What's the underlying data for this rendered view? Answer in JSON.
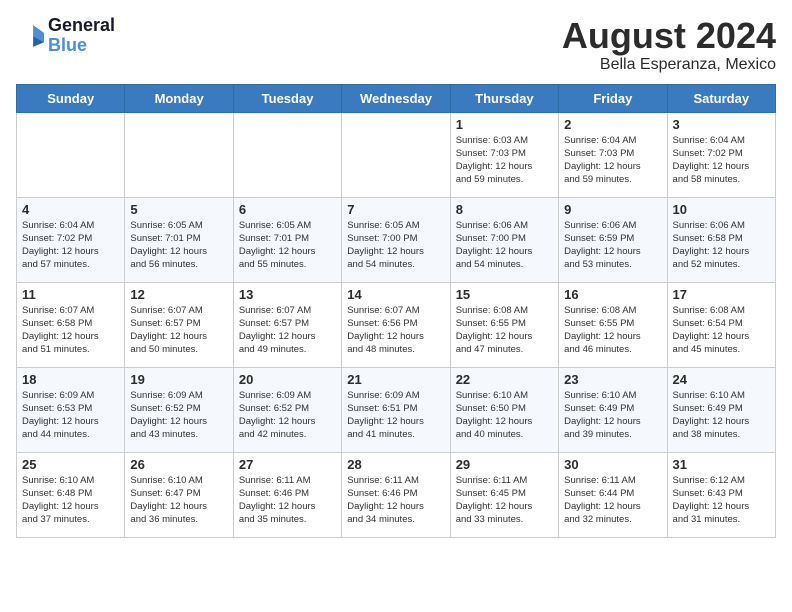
{
  "header": {
    "logo_line1": "General",
    "logo_line2": "Blue",
    "month_year": "August 2024",
    "location": "Bella Esperanza, Mexico"
  },
  "weekdays": [
    "Sunday",
    "Monday",
    "Tuesday",
    "Wednesday",
    "Thursday",
    "Friday",
    "Saturday"
  ],
  "weeks": [
    [
      {
        "day": "",
        "info": ""
      },
      {
        "day": "",
        "info": ""
      },
      {
        "day": "",
        "info": ""
      },
      {
        "day": "",
        "info": ""
      },
      {
        "day": "1",
        "info": "Sunrise: 6:03 AM\nSunset: 7:03 PM\nDaylight: 12 hours\nand 59 minutes."
      },
      {
        "day": "2",
        "info": "Sunrise: 6:04 AM\nSunset: 7:03 PM\nDaylight: 12 hours\nand 59 minutes."
      },
      {
        "day": "3",
        "info": "Sunrise: 6:04 AM\nSunset: 7:02 PM\nDaylight: 12 hours\nand 58 minutes."
      }
    ],
    [
      {
        "day": "4",
        "info": "Sunrise: 6:04 AM\nSunset: 7:02 PM\nDaylight: 12 hours\nand 57 minutes."
      },
      {
        "day": "5",
        "info": "Sunrise: 6:05 AM\nSunset: 7:01 PM\nDaylight: 12 hours\nand 56 minutes."
      },
      {
        "day": "6",
        "info": "Sunrise: 6:05 AM\nSunset: 7:01 PM\nDaylight: 12 hours\nand 55 minutes."
      },
      {
        "day": "7",
        "info": "Sunrise: 6:05 AM\nSunset: 7:00 PM\nDaylight: 12 hours\nand 54 minutes."
      },
      {
        "day": "8",
        "info": "Sunrise: 6:06 AM\nSunset: 7:00 PM\nDaylight: 12 hours\nand 54 minutes."
      },
      {
        "day": "9",
        "info": "Sunrise: 6:06 AM\nSunset: 6:59 PM\nDaylight: 12 hours\nand 53 minutes."
      },
      {
        "day": "10",
        "info": "Sunrise: 6:06 AM\nSunset: 6:58 PM\nDaylight: 12 hours\nand 52 minutes."
      }
    ],
    [
      {
        "day": "11",
        "info": "Sunrise: 6:07 AM\nSunset: 6:58 PM\nDaylight: 12 hours\nand 51 minutes."
      },
      {
        "day": "12",
        "info": "Sunrise: 6:07 AM\nSunset: 6:57 PM\nDaylight: 12 hours\nand 50 minutes."
      },
      {
        "day": "13",
        "info": "Sunrise: 6:07 AM\nSunset: 6:57 PM\nDaylight: 12 hours\nand 49 minutes."
      },
      {
        "day": "14",
        "info": "Sunrise: 6:07 AM\nSunset: 6:56 PM\nDaylight: 12 hours\nand 48 minutes."
      },
      {
        "day": "15",
        "info": "Sunrise: 6:08 AM\nSunset: 6:55 PM\nDaylight: 12 hours\nand 47 minutes."
      },
      {
        "day": "16",
        "info": "Sunrise: 6:08 AM\nSunset: 6:55 PM\nDaylight: 12 hours\nand 46 minutes."
      },
      {
        "day": "17",
        "info": "Sunrise: 6:08 AM\nSunset: 6:54 PM\nDaylight: 12 hours\nand 45 minutes."
      }
    ],
    [
      {
        "day": "18",
        "info": "Sunrise: 6:09 AM\nSunset: 6:53 PM\nDaylight: 12 hours\nand 44 minutes."
      },
      {
        "day": "19",
        "info": "Sunrise: 6:09 AM\nSunset: 6:52 PM\nDaylight: 12 hours\nand 43 minutes."
      },
      {
        "day": "20",
        "info": "Sunrise: 6:09 AM\nSunset: 6:52 PM\nDaylight: 12 hours\nand 42 minutes."
      },
      {
        "day": "21",
        "info": "Sunrise: 6:09 AM\nSunset: 6:51 PM\nDaylight: 12 hours\nand 41 minutes."
      },
      {
        "day": "22",
        "info": "Sunrise: 6:10 AM\nSunset: 6:50 PM\nDaylight: 12 hours\nand 40 minutes."
      },
      {
        "day": "23",
        "info": "Sunrise: 6:10 AM\nSunset: 6:49 PM\nDaylight: 12 hours\nand 39 minutes."
      },
      {
        "day": "24",
        "info": "Sunrise: 6:10 AM\nSunset: 6:49 PM\nDaylight: 12 hours\nand 38 minutes."
      }
    ],
    [
      {
        "day": "25",
        "info": "Sunrise: 6:10 AM\nSunset: 6:48 PM\nDaylight: 12 hours\nand 37 minutes."
      },
      {
        "day": "26",
        "info": "Sunrise: 6:10 AM\nSunset: 6:47 PM\nDaylight: 12 hours\nand 36 minutes."
      },
      {
        "day": "27",
        "info": "Sunrise: 6:11 AM\nSunset: 6:46 PM\nDaylight: 12 hours\nand 35 minutes."
      },
      {
        "day": "28",
        "info": "Sunrise: 6:11 AM\nSunset: 6:46 PM\nDaylight: 12 hours\nand 34 minutes."
      },
      {
        "day": "29",
        "info": "Sunrise: 6:11 AM\nSunset: 6:45 PM\nDaylight: 12 hours\nand 33 minutes."
      },
      {
        "day": "30",
        "info": "Sunrise: 6:11 AM\nSunset: 6:44 PM\nDaylight: 12 hours\nand 32 minutes."
      },
      {
        "day": "31",
        "info": "Sunrise: 6:12 AM\nSunset: 6:43 PM\nDaylight: 12 hours\nand 31 minutes."
      }
    ]
  ]
}
